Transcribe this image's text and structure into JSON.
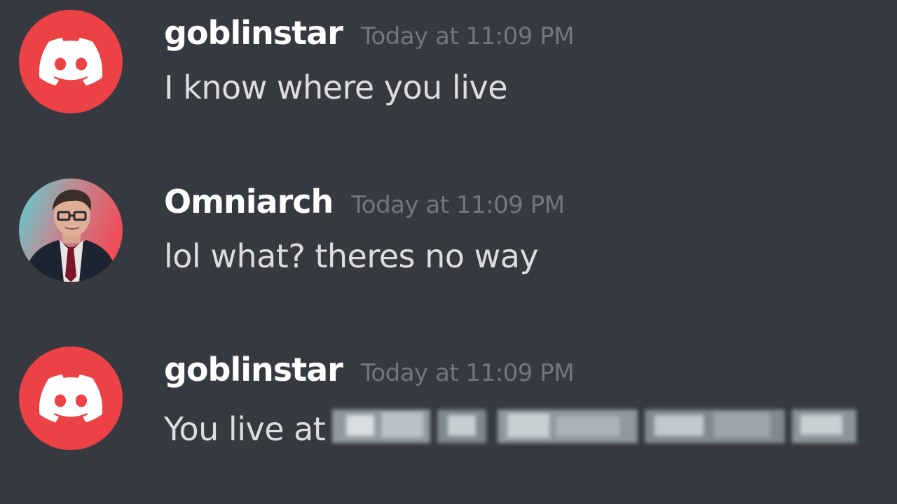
{
  "messages": [
    {
      "author": "goblinstar",
      "timestamp": "Today at 11:09 PM",
      "text": "I know where you live",
      "avatar": "discord-logo-icon",
      "avatar_color": "#ed4245"
    },
    {
      "author": "Omniarch",
      "timestamp": "Today at 11:09 PM",
      "text": "lol what? theres no way",
      "avatar": "user-photo"
    },
    {
      "author": "goblinstar",
      "timestamp": "Today at 11:09 PM",
      "text": "You live at",
      "avatar": "discord-logo-icon",
      "avatar_color": "#ed4245",
      "redacted": true
    }
  ],
  "colors": {
    "background": "#36393f",
    "username": "#ffffff",
    "timestamp": "#72767d",
    "message_text": "#dcddde",
    "discord_red": "#ed4245"
  }
}
